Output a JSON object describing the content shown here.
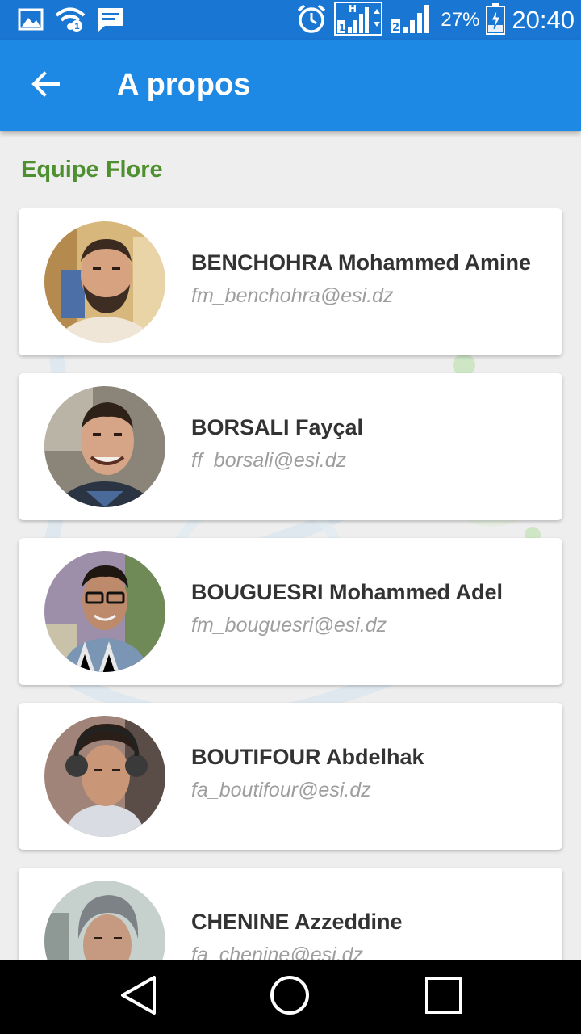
{
  "status_bar": {
    "battery_percent": "27%",
    "time": "20:40",
    "sim1_label": "1",
    "sim2_label": "2",
    "network_label": "H",
    "icons": [
      "image-icon",
      "wifi-icon",
      "message-icon",
      "alarm-icon",
      "signal-icon",
      "battery-charging-icon"
    ]
  },
  "app_bar": {
    "title": "A propos",
    "back_icon": "arrow-back-icon"
  },
  "section": {
    "title": "Equipe Flore"
  },
  "members": [
    {
      "name": "BENCHOHRA Mohammed Amine",
      "email": "fm_benchohra@esi.dz"
    },
    {
      "name": "BORSALI Fayçal",
      "email": "ff_borsali@esi.dz"
    },
    {
      "name": "BOUGUESRI Mohammed Adel",
      "email": "fm_bouguesri@esi.dz"
    },
    {
      "name": "BOUTIFOUR Abdelhak",
      "email": "fa_boutifour@esi.dz"
    },
    {
      "name": "CHENINE Azzeddine",
      "email": "fa_chenine@esi.dz"
    }
  ],
  "nav_bar": {
    "icons": [
      "back-triangle-icon",
      "home-circle-icon",
      "recents-square-icon"
    ]
  },
  "colors": {
    "status_bar": "#1976d2",
    "app_bar": "#1e88e5",
    "section_title": "#4e8f2f",
    "name_text": "#333333",
    "email_text": "#9e9e9e"
  }
}
